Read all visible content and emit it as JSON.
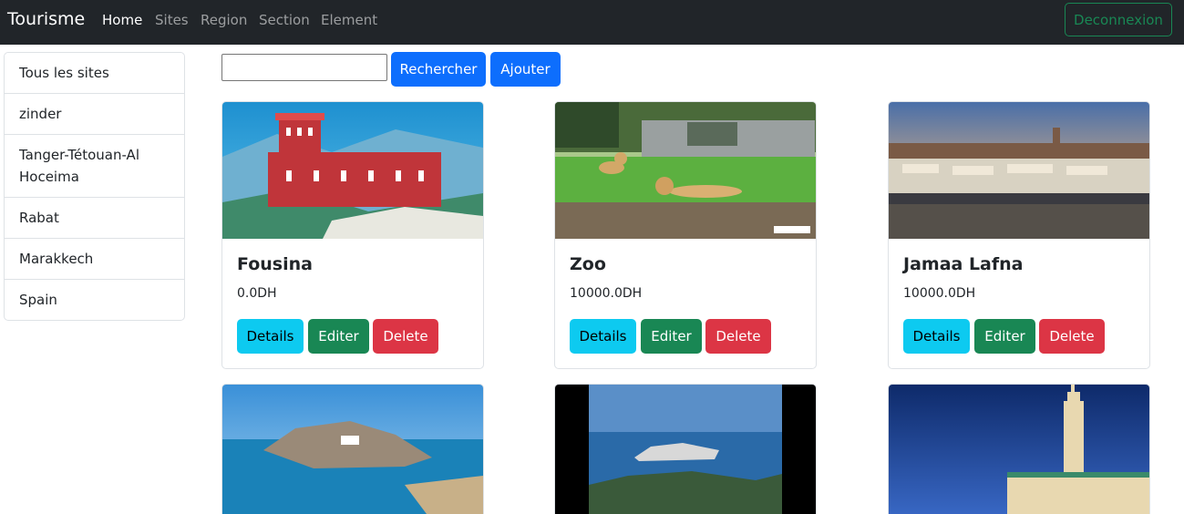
{
  "navbar": {
    "brand": "Tourisme",
    "links": [
      "Home",
      "Sites",
      "Region",
      "Section",
      "Element"
    ],
    "logout_label": "Deconnexion"
  },
  "sidebar": {
    "items": [
      "Tous les sites",
      "zinder",
      "Tanger-Tétouan-Al Hoceima",
      "Rabat",
      "Marakkech",
      "Spain"
    ]
  },
  "search": {
    "value": "",
    "button_label": "Rechercher",
    "add_label": "Ajouter"
  },
  "card_buttons": {
    "details": "Details",
    "edit": "Editer",
    "delete": "Delete"
  },
  "cards": [
    {
      "title": "Fousina",
      "price": "0.0DH"
    },
    {
      "title": "Zoo",
      "price": "10000.0DH"
    },
    {
      "title": "Jamaa Lafna",
      "price": "10000.0DH"
    },
    {
      "title": "",
      "price": ""
    },
    {
      "title": "",
      "price": ""
    },
    {
      "title": "",
      "price": ""
    }
  ],
  "colors": {
    "navbar_bg": "#212529",
    "primary": "#0d6efd",
    "info": "#0dcaf0",
    "success": "#198754",
    "danger": "#dc3545"
  }
}
